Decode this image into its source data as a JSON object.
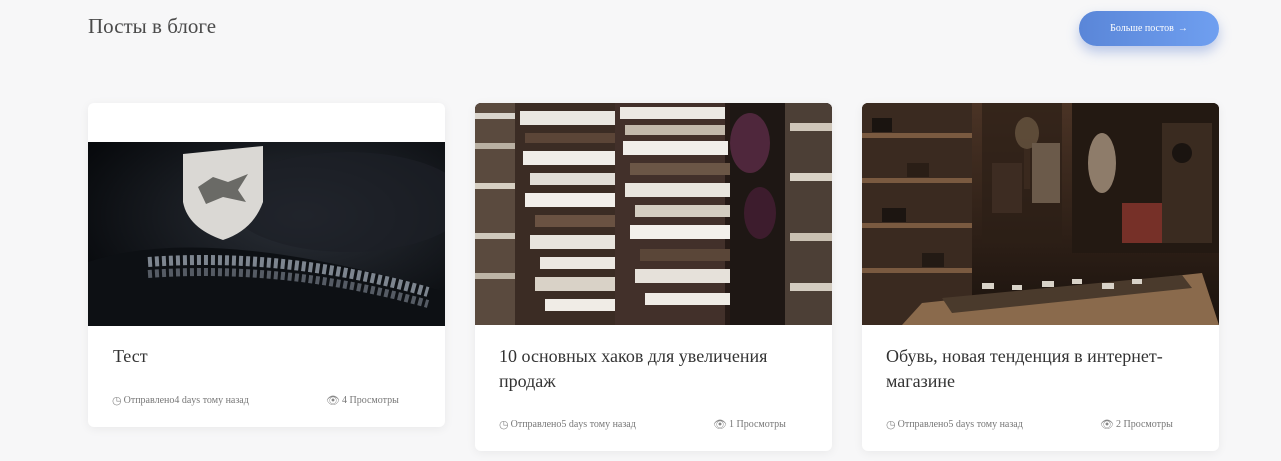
{
  "section": {
    "title": "Посты в блоге",
    "more_button": "Больше постов",
    "more_arrow": "→"
  },
  "posts": [
    {
      "title": "Тест",
      "posted": "Отправлено4 days тому назад",
      "views": "4 Просмотры"
    },
    {
      "title": "10 основных хаков для увеличения продаж",
      "posted": "Отправлено5 days тому назад",
      "views": "1 Просмотры"
    },
    {
      "title": "Обувь, новая тенденция в интернет-магазине",
      "posted": "Отправлено5 days тому назад",
      "views": "2 Просмотры"
    }
  ],
  "icons": {
    "clock": "clock-icon",
    "eye": "eye-icon"
  },
  "colors": {
    "accent": "#6a96e6",
    "background": "#f7f7f8"
  }
}
